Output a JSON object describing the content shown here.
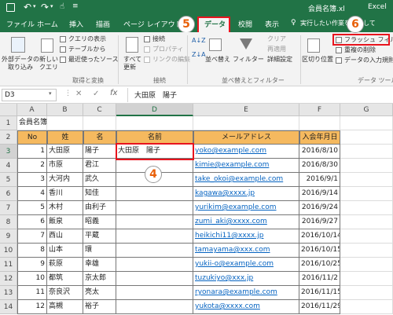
{
  "title_bar": {
    "filename": "会員名簿.xl",
    "app": "Excel"
  },
  "tabs": [
    "ファイル",
    "ホーム",
    "挿入",
    "描画",
    "ページ レイアウト",
    "データ",
    "校閲",
    "表示"
  ],
  "tell_me": "実行したい作業を入力して",
  "ribbon": {
    "get_data": "外部データの\n取り込み",
    "new_query": "新しい\nクエリ",
    "show_query": "クエリの表示",
    "from_table": "テーブルから",
    "recent_sources": "最近使ったソース",
    "group_get_transform": "取得と変換",
    "refresh_all": "すべて\n更新",
    "connections": "接続",
    "properties": "プロパティ",
    "edit_links": "リンクの編集",
    "group_connections": "接続",
    "sort": "並べ替え",
    "filter": "フィルター",
    "clear": "クリア",
    "reapply": "再適用",
    "advanced": "詳細設定",
    "group_sort_filter": "並べ替えとフィルター",
    "text_to_columns": "区切り位置",
    "flash_fill": "フラッシュ フィル",
    "remove_duplicates": "重複の削除",
    "data_validation": "データの入力規則",
    "group_data_tools": "データ ツール"
  },
  "formula_bar": {
    "name_box": "D3",
    "cancel": "✕",
    "enter": "✓",
    "fx": "fx",
    "content": "大田原　陽子"
  },
  "columns": [
    "A",
    "B",
    "C",
    "D",
    "E",
    "F",
    "G"
  ],
  "row_numbers": [
    "1",
    "2",
    "3",
    "4",
    "5",
    "6",
    "7",
    "8",
    "9",
    "10",
    "11",
    "12",
    "13",
    "14"
  ],
  "sheet_title": "会員名簿",
  "table_headers": [
    "No",
    "姓",
    "名",
    "名前",
    "メールアドレス",
    "入会年月日"
  ],
  "rows": [
    [
      "1",
      "大田原",
      "陽子",
      "大田原　陽子",
      "yoko@example.com",
      "2016/8/10"
    ],
    [
      "2",
      "市原",
      "君江",
      "",
      "kimie@example.com",
      "2016/8/30"
    ],
    [
      "3",
      "大河内",
      "武久",
      "",
      "take_okoi@example.com",
      "2016/9/1"
    ],
    [
      "4",
      "香川",
      "知佳",
      "",
      "kagawa@xxxx.jp",
      "2016/9/14"
    ],
    [
      "5",
      "木村",
      "由利子",
      "",
      "yurikim@example.com",
      "2016/9/24"
    ],
    [
      "6",
      "飯泉",
      "昭義",
      "",
      "zumi_aki@xxxx.com",
      "2016/9/27"
    ],
    [
      "7",
      "西山",
      "平蔵",
      "",
      "heikichi11@xxxx.jp",
      "2016/10/14"
    ],
    [
      "8",
      "山本",
      "環",
      "",
      "tamayama@xxx.com",
      "2016/10/15"
    ],
    [
      "9",
      "萩原",
      "幸雄",
      "",
      "yukii-o@example.com",
      "2016/10/25"
    ],
    [
      "10",
      "都筑",
      "京太郎",
      "",
      "tuzukiyo@xxx.jp",
      "2016/11/2"
    ],
    [
      "11",
      "奈良沢",
      "亮太",
      "",
      "ryonara@example.com",
      "2016/11/15"
    ],
    [
      "12",
      "高槻",
      "裕子",
      "",
      "yukota@xxxx.com",
      "2016/11/29"
    ]
  ],
  "annotations": {
    "step4": "4",
    "step5": "5",
    "step6": "6"
  },
  "colors": {
    "excel_green": "#217346",
    "header_fill": "#f5b95f",
    "highlight": "#e8141e",
    "badge": "#e8600a"
  }
}
